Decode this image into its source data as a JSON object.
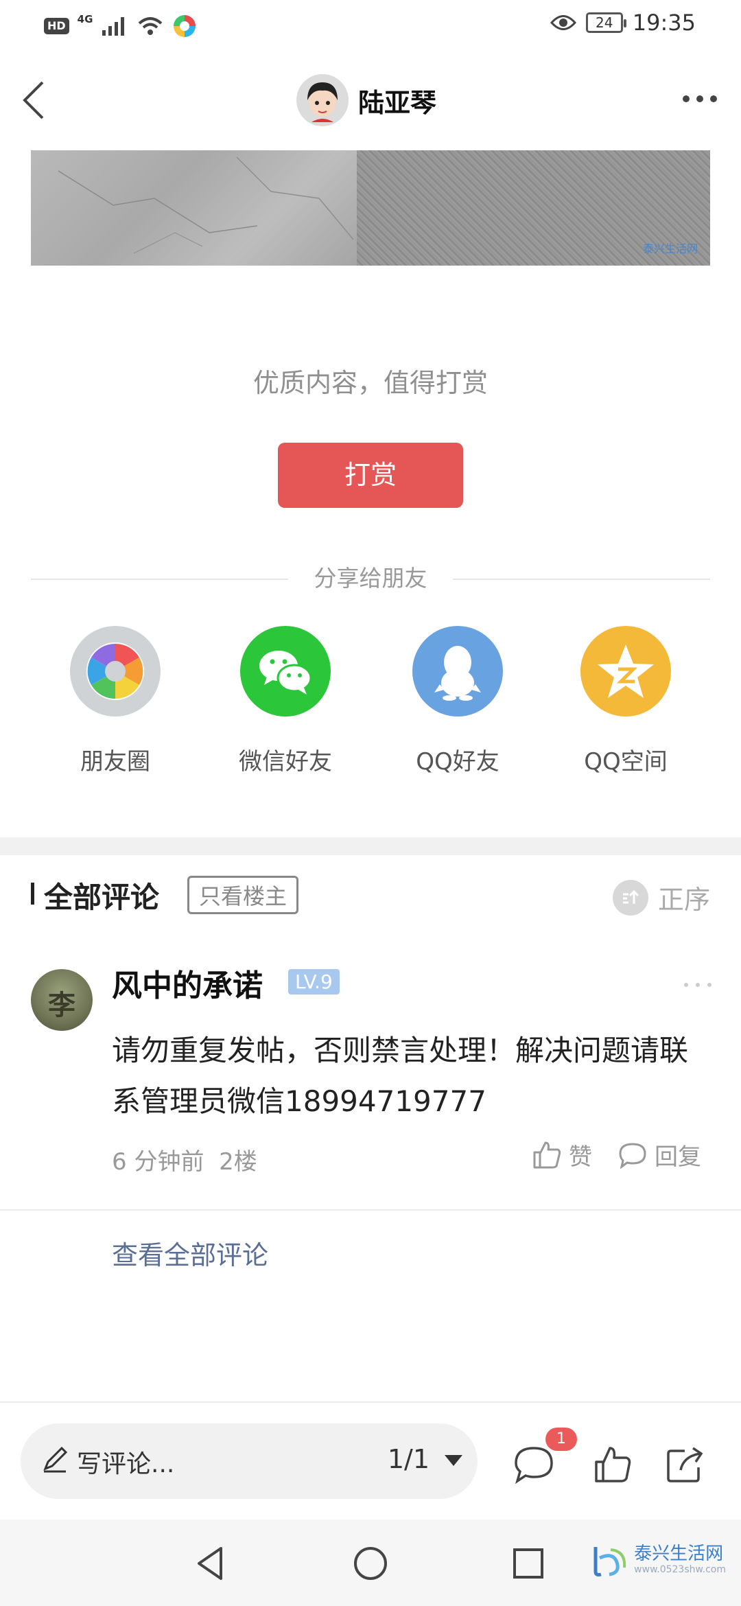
{
  "status_bar": {
    "hd": "HD",
    "network": "4G",
    "battery": "24",
    "time": "19:35"
  },
  "header": {
    "title": "陆亚琴"
  },
  "reward": {
    "prompt": "优质内容，值得打赏",
    "button_label": "打赏"
  },
  "share": {
    "title": "分享给朋友",
    "items": [
      {
        "label": "朋友圈",
        "icon": "moments-icon",
        "color": "#cfd3d6"
      },
      {
        "label": "微信好友",
        "icon": "wechat-icon",
        "color": "#2cc63b"
      },
      {
        "label": "QQ好友",
        "icon": "qq-icon",
        "color": "#69a2e0"
      },
      {
        "label": "QQ空间",
        "icon": "qzone-icon",
        "color": "#f5b93a"
      }
    ]
  },
  "comments": {
    "title": "全部评论",
    "only_host": "只看楼主",
    "order": "正序",
    "items": [
      {
        "avatar_text": "李",
        "name": "风中的承诺",
        "level": "LV.9",
        "text": "请勿重复发帖，否则禁言处理！解决问题请联系管理员微信18994719777",
        "time": "6 分钟前",
        "floor": "2楼",
        "like_label": "赞",
        "reply_label": "回复"
      }
    ],
    "view_all": "查看全部评论"
  },
  "bottom_bar": {
    "input_placeholder": "写评论...",
    "page_indicator": "1/1",
    "comment_badge": "1"
  },
  "watermark": {
    "small": "泰兴生活网",
    "text": "泰兴生活网",
    "url": "www.0523shw.com"
  },
  "colors": {
    "accent_red": "#e55757",
    "link_blue": "#5a6f93",
    "level_badge": "#a9c8ee"
  }
}
